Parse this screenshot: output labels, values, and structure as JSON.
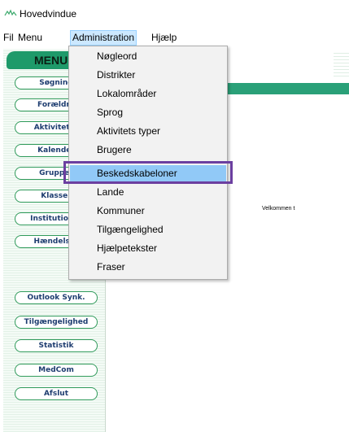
{
  "window": {
    "title": "Hovedvindue"
  },
  "menubar": {
    "items": [
      "Fil",
      "Menu",
      "Administration",
      "Hjælp"
    ],
    "active": "Administration"
  },
  "left_panel": {
    "header": "MENU",
    "buttons": [
      "Søgning",
      "Forældre",
      "Aktiviteter",
      "Kalender",
      "Grupper",
      "Klasser",
      "Institutioner",
      "Hændelser",
      "Outlook Synk.",
      "Tilgængelighed",
      "Statistik",
      "MedCom",
      "Afslut"
    ]
  },
  "main": {
    "welcome_text": "Velkommen t"
  },
  "dropdown": {
    "items": [
      "Nøgleord",
      "Distrikter",
      "Lokalområder",
      "Sprog",
      "Aktivitets typer",
      "Brugere",
      "Beskedskabeloner",
      "Lande",
      "Kommuner",
      "Tilgængelighed",
      "Hjælpetekster",
      "Fraser"
    ],
    "highlighted": "Beskedskabeloner"
  },
  "colors": {
    "accent_green": "#1e9a6a",
    "highlight_purple": "#6b3fa0",
    "hover_blue": "#91c9f7"
  }
}
